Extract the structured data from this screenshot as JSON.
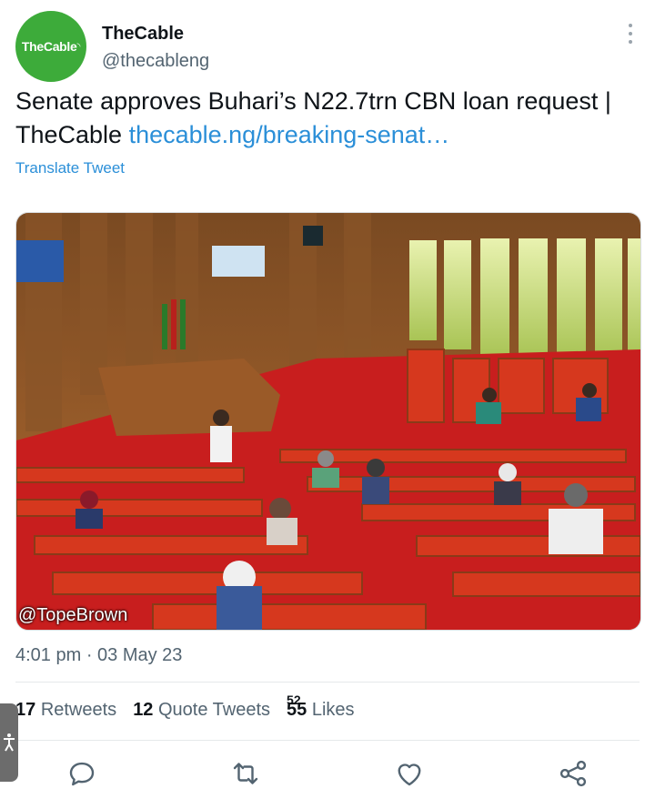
{
  "account": {
    "logo_text": "TheCable",
    "name": "TheCable",
    "handle": "@thecableng"
  },
  "tweet": {
    "text": "Senate approves Buhari’s N22.7trn CBN loan request | TheCable ",
    "link_text": "thecable.ng/breaking-senat…",
    "translate_label": "Translate Tweet"
  },
  "media": {
    "credit": "@TopeBrown",
    "description_icon": "senate-chamber-photo"
  },
  "meta": {
    "timestamp": "4:01 pm · 03 May 23"
  },
  "stats": {
    "retweets_count": "17",
    "retweets_label": "Retweets",
    "quotes_count": "12",
    "quotes_label": "Quote Tweets",
    "likes_count": "55",
    "likes_count_overlay": "52",
    "likes_label": "Likes"
  },
  "actions": {
    "reply_icon": "reply-icon",
    "retweet_icon": "retweet-icon",
    "like_icon": "heart-icon",
    "share_icon": "share-icon"
  },
  "colors": {
    "brand_green": "#3dab3a",
    "link_blue": "#2b8fd8",
    "secondary_text": "#536471",
    "icon_color": "#536471"
  }
}
